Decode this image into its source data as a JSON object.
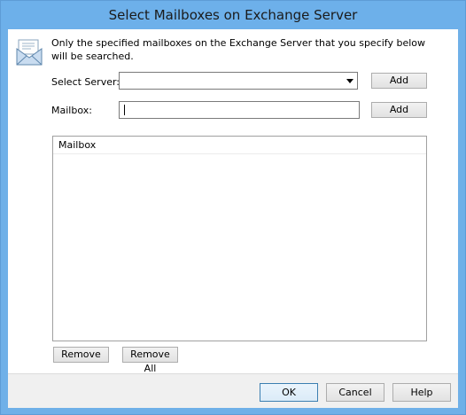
{
  "window": {
    "title": "Select Mailboxes on Exchange Server"
  },
  "intro": {
    "text": "Only the specified mailboxes on the Exchange Server that you specify below will be searched."
  },
  "server": {
    "label": "Select Server:",
    "value": "",
    "add_label": "Add"
  },
  "mailbox": {
    "label": "Mailbox:",
    "value": "",
    "add_label": "Add"
  },
  "list": {
    "columns": [
      "Mailbox"
    ],
    "rows": []
  },
  "actions": {
    "remove_label": "Remove",
    "remove_all_label": "Remove All"
  },
  "footer": {
    "ok_label": "OK",
    "cancel_label": "Cancel",
    "help_label": "Help"
  },
  "icons": {
    "header_icon": "mail-envelope-icon"
  },
  "colors": {
    "titlebar": "#6db0ea",
    "default_button_border": "#3c7fb1"
  }
}
